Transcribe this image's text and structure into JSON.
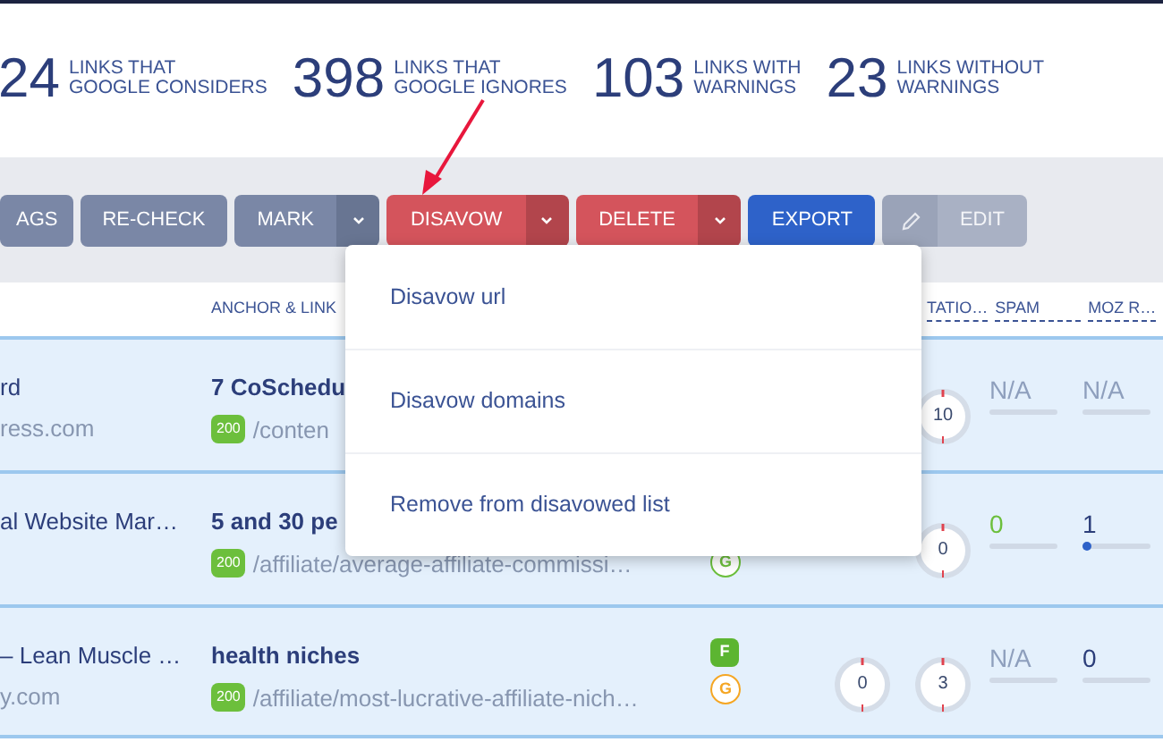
{
  "stats": [
    {
      "value": "24",
      "label_lines": [
        "LINKS THAT",
        "GOOGLE CONSIDERS"
      ]
    },
    {
      "value": "398",
      "label_lines": [
        "LINKS THAT",
        "GOOGLE IGNORES"
      ]
    },
    {
      "value": "103",
      "label_lines": [
        "LINKS WITH",
        "WARNINGS"
      ]
    },
    {
      "value": "23",
      "label_lines": [
        "LINKS WITHOUT",
        "WARNINGS"
      ]
    }
  ],
  "toolbar": [
    {
      "label": "AGS",
      "kind": "gray",
      "split": false,
      "disabled": false
    },
    {
      "label": "RE-CHECK",
      "kind": "gray",
      "split": false,
      "disabled": false
    },
    {
      "label": "MARK",
      "kind": "gray",
      "split": true,
      "disabled": false
    },
    {
      "label": "DISAVOW",
      "kind": "red",
      "split": true,
      "disabled": false
    },
    {
      "label": "DELETE",
      "kind": "red",
      "split": true,
      "disabled": false
    },
    {
      "label": "EXPORT",
      "kind": "blue",
      "split": false,
      "disabled": false
    },
    {
      "label": "EDIT",
      "kind": "edit",
      "split": false,
      "disabled": true
    }
  ],
  "table": {
    "columns": [
      "ANCHOR & LINK",
      "TATIO…",
      "SPAM",
      "MOZ R…"
    ],
    "rows": [
      {
        "title": "rd",
        "domain": "ress.com",
        "anchor": "7 CoSchedu",
        "status": "200",
        "path": "/conten",
        "badges": [],
        "circle_2": {
          "value": "10"
        },
        "spam": {
          "value": "N/A",
          "kind": "na"
        },
        "moz": {
          "value": "N/A",
          "kind": "na"
        }
      },
      {
        "title": "al Website Mar…",
        "anchor": "5 and 30 pe",
        "status": "200",
        "path": "/affiliate/average-affiliate-commissi…",
        "badges": [
          {
            "kind": "circle",
            "letter": "G",
            "color": "#6cbf3c"
          }
        ],
        "circle_2": {
          "value": "0"
        },
        "spam": {
          "value": "0",
          "kind": "good"
        },
        "moz": {
          "value": "1",
          "kind": "number",
          "level": 0.02
        }
      },
      {
        "title": "– Lean Muscle …",
        "domain": "y.com",
        "anchor": "health niches",
        "status": "200",
        "path": "/affiliate/most-lucrative-affiliate-nich…",
        "badges": [
          {
            "kind": "square",
            "letter": "F",
            "color": "#5cb531"
          },
          {
            "kind": "circle",
            "letter": "G",
            "color": "#f5a623"
          }
        ],
        "circle_1": {
          "value": "0"
        },
        "circle_2": {
          "value": "3"
        },
        "spam": {
          "value": "N/A",
          "kind": "na"
        },
        "moz": {
          "value": "0",
          "kind": "number"
        }
      }
    ]
  },
  "disavow_menu": {
    "items": [
      "Disavow url",
      "Disavow domains",
      "Remove from disavowed list"
    ]
  }
}
